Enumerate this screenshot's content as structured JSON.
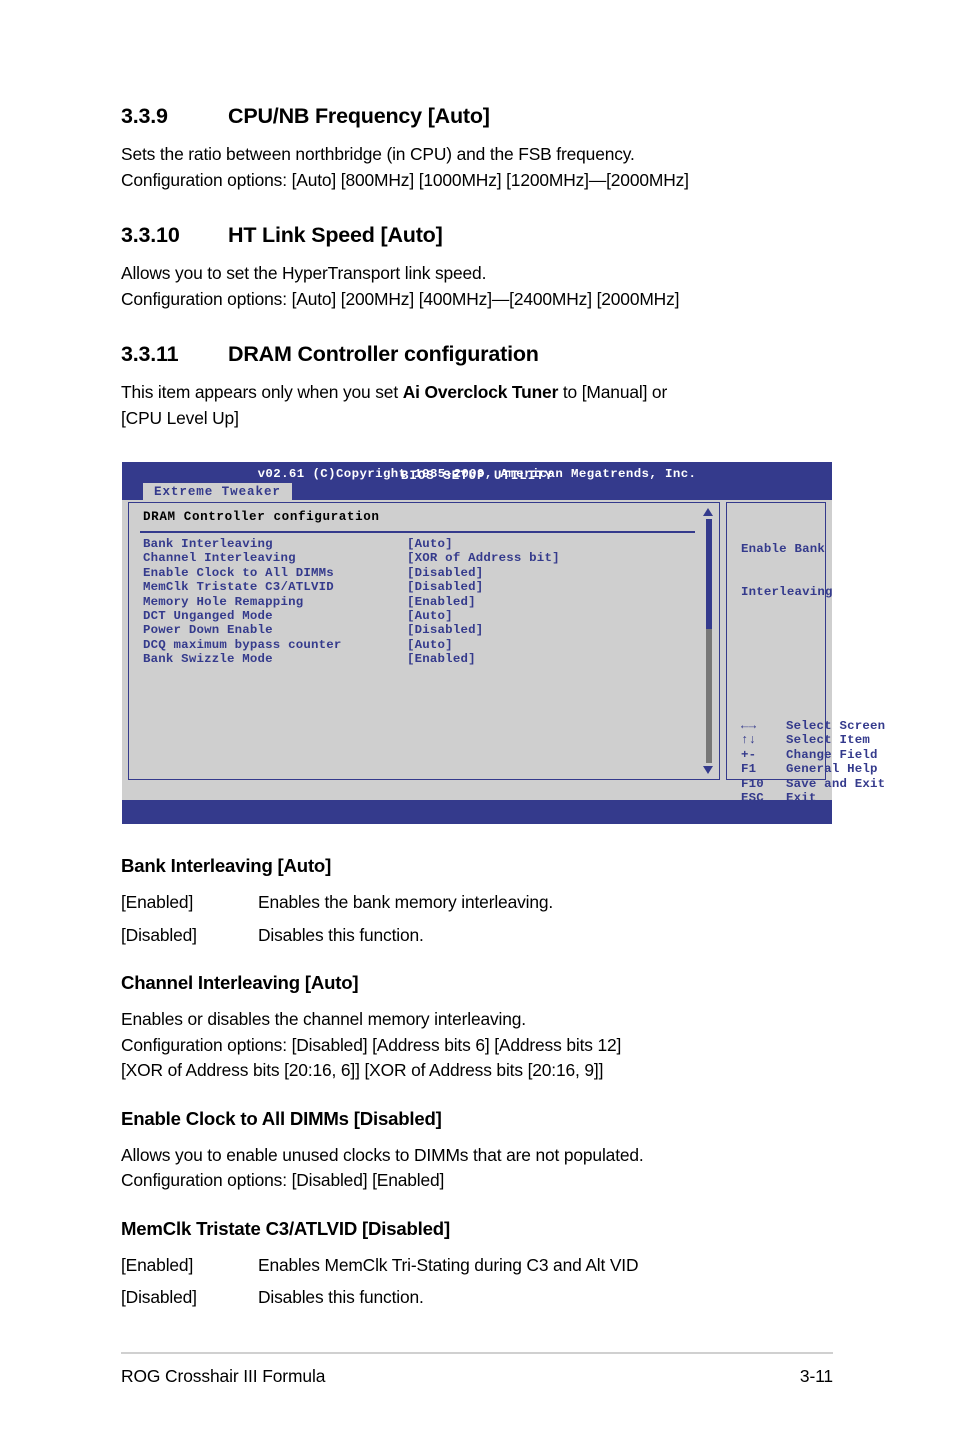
{
  "sections": [
    {
      "number": "3.3.9",
      "title": "CPU/NB Frequency [Auto]",
      "lines": [
        "Sets the ratio between northbridge (in CPU) and the FSB frequency.",
        "Configuration options: [Auto] [800MHz] [1000MHz] [1200MHz]—[2000MHz]"
      ]
    },
    {
      "number": "3.3.10",
      "title": "HT Link Speed [Auto]",
      "lines": [
        "Allows you to set the HyperTransport link speed.",
        "Configuration options: [Auto] [200MHz] [400MHz]—[2400MHz] [2000MHz]"
      ]
    },
    {
      "number": "3.3.11",
      "title": "DRAM Controller configuration",
      "intro_pre": "This item appears only when you set ",
      "intro_bold": "Ai Overclock Tuner",
      "intro_post": " to [Manual] or",
      "intro_line2": "[CPU Level Up]"
    }
  ],
  "bios": {
    "window_title": "BIOS SETUP UTILITY",
    "tab_label": "Extreme Tweaker",
    "panel_title": "DRAM Controller configuration",
    "items": [
      {
        "label": "Bank Interleaving",
        "value": "[Auto]"
      },
      {
        "label": "Channel Interleaving",
        "value": "[XOR of Address bit]"
      },
      {
        "label": "Enable Clock to All DIMMs",
        "value": "[Disabled]"
      },
      {
        "label": "MemClk Tristate C3/ATLVID",
        "value": "[Disabled]"
      },
      {
        "label": "Memory Hole Remapping",
        "value": "[Enabled]"
      },
      {
        "label": "DCT Unganged Mode",
        "value": "[Auto]"
      },
      {
        "label": "Power Down Enable",
        "value": "[Disabled]"
      },
      {
        "label": "DCQ maximum bypass counter",
        "value": "[Auto]"
      },
      {
        "label": "Bank Swizzle Mode",
        "value": "[Enabled]"
      }
    ],
    "help_line1": "Enable Bank",
    "help_line2": "Interleaving",
    "legend": [
      {
        "key": "←→",
        "desc": "Select Screen"
      },
      {
        "key": "↑↓",
        "desc": "Select Item"
      },
      {
        "key": "+-",
        "desc": "Change Field"
      },
      {
        "key": "F1",
        "desc": "General Help"
      },
      {
        "key": "F10",
        "desc": "Save and Exit"
      },
      {
        "key": "ESC",
        "desc": "Exit"
      }
    ],
    "copyright": "v02.61  (C)Copyright 1985-2009, American Megatrends, Inc.",
    "colors": {
      "chrome_blue": "#343a8c",
      "panel_gray": "#cfcfcf",
      "scroll_track": "#777777"
    }
  },
  "subsections": [
    {
      "heading": "Bank Interleaving [Auto]",
      "type": "deflist",
      "rows": [
        {
          "term": "[Enabled]",
          "desc": "Enables the bank memory interleaving."
        },
        {
          "term": "[Disabled]",
          "desc": "Disables this function."
        }
      ]
    },
    {
      "heading": "Channel Interleaving [Auto]",
      "type": "paragraph",
      "lines": [
        "Enables or disables the channel memory interleaving.",
        "Configuration options: [Disabled] [Address bits 6] [Address bits 12]",
        "[XOR of Address bits [20:16, 6]] [XOR of Address bits [20:16, 9]]"
      ]
    },
    {
      "heading": "Enable Clock to All DIMMs [Disabled]",
      "type": "paragraph",
      "lines": [
        "Allows you to enable unused clocks to DIMMs that are not populated.",
        "Configuration options: [Disabled] [Enabled]"
      ]
    },
    {
      "heading": "MemClk Tristate C3/ATLVID [Disabled]",
      "type": "deflist",
      "rows": [
        {
          "term": "[Enabled]",
          "desc": "Enables MemClk Tri-Stating during C3 and Alt VID"
        },
        {
          "term": "[Disabled]",
          "desc": "Disables this function."
        }
      ]
    }
  ],
  "footer": {
    "left": "ROG Crosshair III Formula",
    "right": "3-11"
  }
}
